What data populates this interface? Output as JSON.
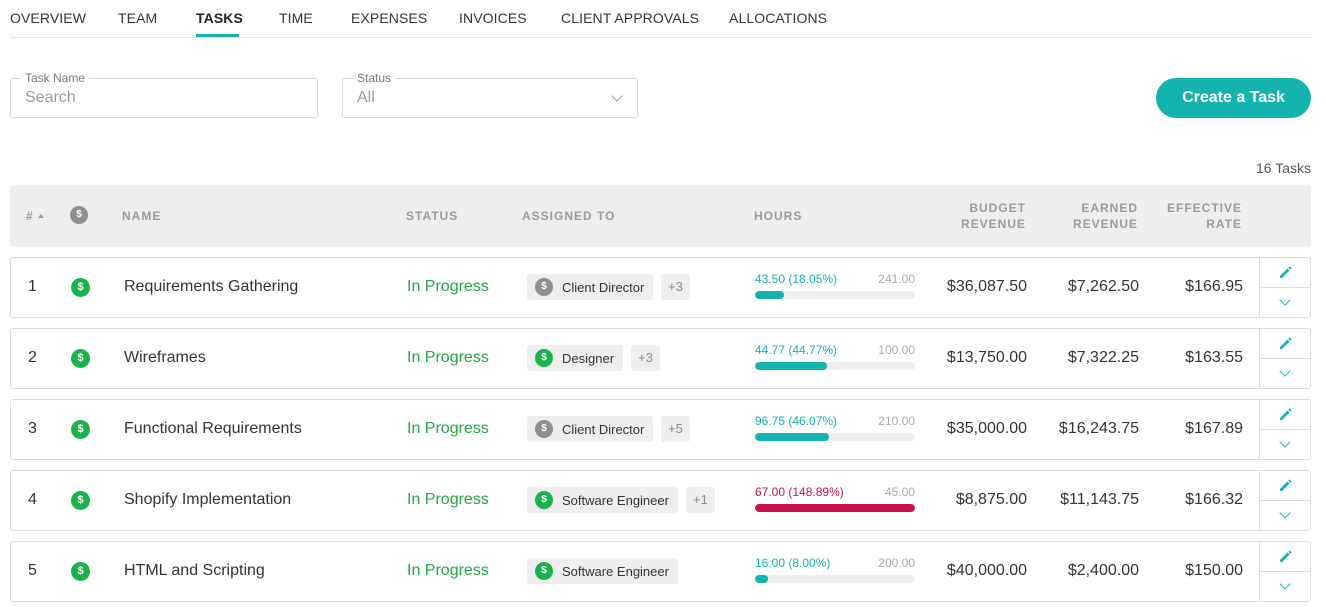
{
  "tabs": [
    {
      "label": "OVERVIEW",
      "active": false
    },
    {
      "label": "TEAM",
      "active": false
    },
    {
      "label": "TASKS",
      "active": true
    },
    {
      "label": "TIME",
      "active": false
    },
    {
      "label": "EXPENSES",
      "active": false
    },
    {
      "label": "INVOICES",
      "active": false
    },
    {
      "label": "CLIENT APPROVALS",
      "active": false
    },
    {
      "label": "ALLOCATIONS",
      "active": false
    }
  ],
  "filters": {
    "task_name": {
      "label": "Task Name",
      "placeholder": "Search"
    },
    "status": {
      "label": "Status",
      "value": "All"
    }
  },
  "create_button": "Create a Task",
  "task_count": "16 Tasks",
  "columns": {
    "num": "#",
    "billable_icon": "$",
    "name": "NAME",
    "status": "STATUS",
    "assigned": "ASSIGNED TO",
    "hours": "HOURS",
    "budget_line1": "BUDGET",
    "budget_line2": "REVENUE",
    "earned_line1": "EARNED",
    "earned_line2": "REVENUE",
    "rate_line1": "EFFECTIVE",
    "rate_line2": "RATE"
  },
  "colors": {
    "accent": "#15b3ad",
    "billable_green": "#19b24b",
    "in_progress": "#20a845",
    "over_budget": "#c8104f",
    "non_billable_grey": "#8f8f8f"
  },
  "rows": [
    {
      "num": "1",
      "billable_icon": "$",
      "name": "Requirements Gathering",
      "status": "In Progress",
      "role": "Client Director",
      "role_billable": false,
      "more": "+3",
      "hours_used": "43.50 (18.05%)",
      "hours_total": "241.00",
      "progress": 0.1805,
      "over": false,
      "budget": "$36,087.50",
      "earned": "$7,262.50",
      "rate": "$166.95"
    },
    {
      "num": "2",
      "billable_icon": "$",
      "name": "Wireframes",
      "status": "In Progress",
      "role": "Designer",
      "role_billable": true,
      "more": "+3",
      "hours_used": "44.77 (44.77%)",
      "hours_total": "100.00",
      "progress": 0.4477,
      "over": false,
      "budget": "$13,750.00",
      "earned": "$7,322.25",
      "rate": "$163.55"
    },
    {
      "num": "3",
      "billable_icon": "$",
      "name": "Functional Requirements",
      "status": "In Progress",
      "role": "Client Director",
      "role_billable": false,
      "more": "+5",
      "hours_used": "96.75 (46.07%)",
      "hours_total": "210.00",
      "progress": 0.4607,
      "over": false,
      "budget": "$35,000.00",
      "earned": "$16,243.75",
      "rate": "$167.89"
    },
    {
      "num": "4",
      "billable_icon": "$",
      "name": "Shopify Implementation",
      "status": "In Progress",
      "role": "Software Engineer",
      "role_billable": true,
      "more": "+1",
      "hours_used": "67.00 (148.89%)",
      "hours_total": "45.00",
      "progress": 1.0,
      "over": true,
      "budget": "$8,875.00",
      "earned": "$11,143.75",
      "rate": "$166.32"
    },
    {
      "num": "5",
      "billable_icon": "$",
      "name": "HTML and Scripting",
      "status": "In Progress",
      "role": "Software Engineer",
      "role_billable": true,
      "more": "",
      "hours_used": "16.00 (8.00%)",
      "hours_total": "200.00",
      "progress": 0.08,
      "over": false,
      "budget": "$40,000.00",
      "earned": "$2,400.00",
      "rate": "$150.00"
    }
  ]
}
